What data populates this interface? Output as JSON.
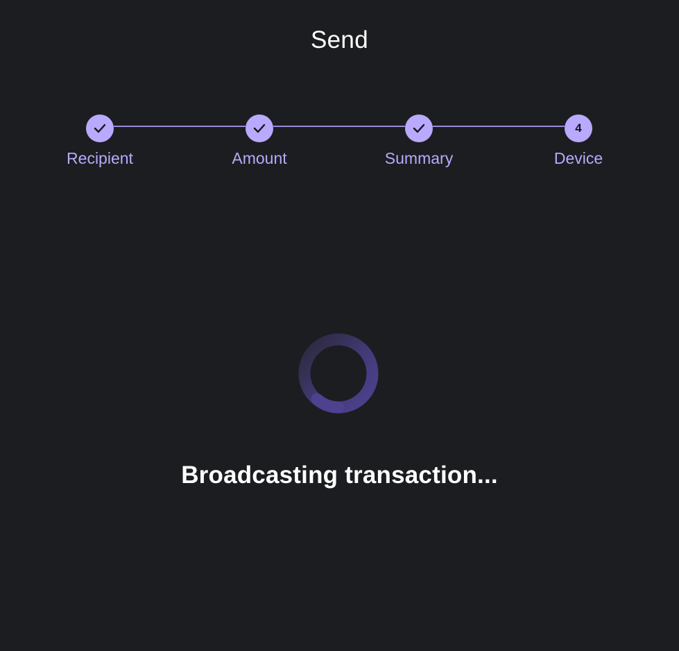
{
  "header": {
    "title": "Send"
  },
  "stepper": {
    "steps": [
      {
        "label": "Recipient",
        "state": "completed",
        "icon": "check-icon"
      },
      {
        "label": "Amount",
        "state": "completed",
        "icon": "check-icon"
      },
      {
        "label": "Summary",
        "state": "completed",
        "icon": "check-icon"
      },
      {
        "label": "Device",
        "state": "active",
        "number": "4"
      }
    ]
  },
  "main": {
    "spinner_icon": "loading-spinner-icon",
    "status_text": "Broadcasting transaction..."
  },
  "colors": {
    "background": "#1c1d20",
    "accent": "#b9a9ff",
    "connector": "#9b8ad9",
    "spinner": "#4d4190",
    "text": "#ffffff"
  }
}
